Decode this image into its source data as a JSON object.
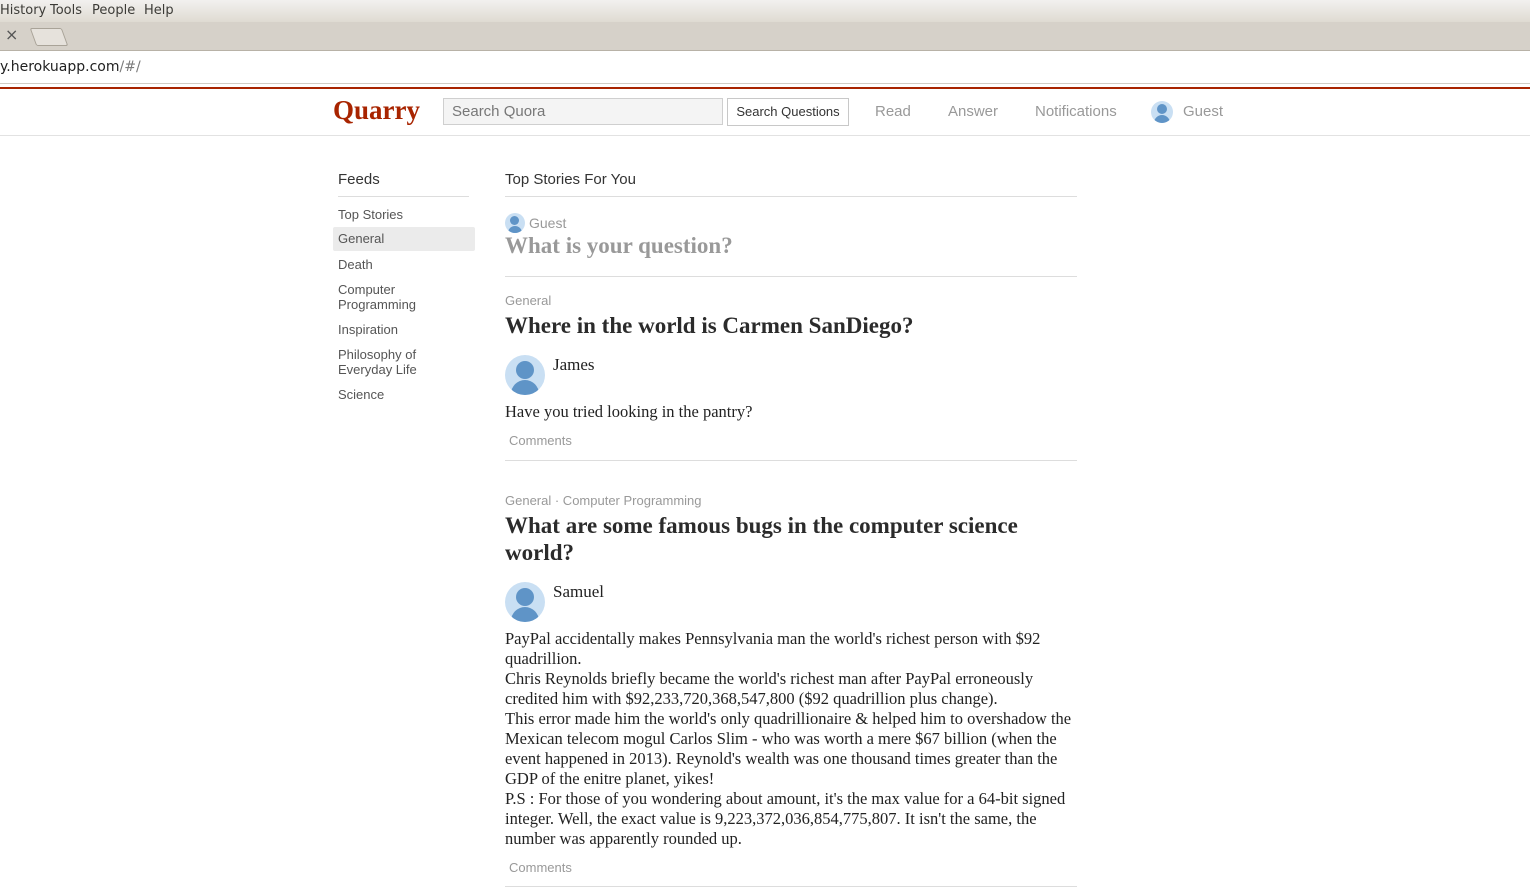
{
  "browser": {
    "menu": [
      "History",
      "Tools",
      "People",
      "Help"
    ],
    "tab_close": "×",
    "url_host": "y.herokuapp.com",
    "url_path": "/#/"
  },
  "header": {
    "logo": "Quarry",
    "search_placeholder": "Search Quora",
    "search_button": "Search Questions",
    "nav": [
      "Read",
      "Answer",
      "Notifications"
    ],
    "user": "Guest"
  },
  "sidebar": {
    "title": "Feeds",
    "items": [
      "Top Stories",
      "General",
      "Death",
      "Computer Programming",
      "Inspiration",
      "Philosophy of Everyday Life",
      "Science"
    ],
    "active_item": "General"
  },
  "main": {
    "title": "Top Stories For You",
    "ask": {
      "user": "Guest",
      "prompt": "What is your question?"
    },
    "stories": [
      {
        "topics": "General",
        "question": "Where in the world is Carmen SanDiego?",
        "author": "James",
        "answer": [
          "Have you tried looking in the pantry?"
        ],
        "comments_label": "Comments"
      },
      {
        "topics": "General · Computer Programming",
        "question": "What are some famous bugs in the computer science world?",
        "author": "Samuel",
        "answer": [
          "PayPal accidentally makes Pennsylvania man the world's richest person with $92 quadrillion.",
          "Chris Reynolds briefly became the world's richest man after PayPal erroneously credited him with $92,233,720,368,547,800 ($92 quadrillion plus change).",
          "This error made him the world's only quadrillionaire & helped him to overshadow the Mexican telecom mogul Carlos Slim - who was worth a mere $67 billion (when the event happened in 2013). Reynold's wealth was one thousand times greater than the GDP of the enitre planet, yikes!",
          "P.S : For those of you wondering about amount, it's the max value for a 64-bit signed integer. Well, the exact value is 9,223,372,036,854,775,807. It isn't the same, the number was apparently rounded up."
        ],
        "comments_label": "Comments"
      }
    ]
  }
}
